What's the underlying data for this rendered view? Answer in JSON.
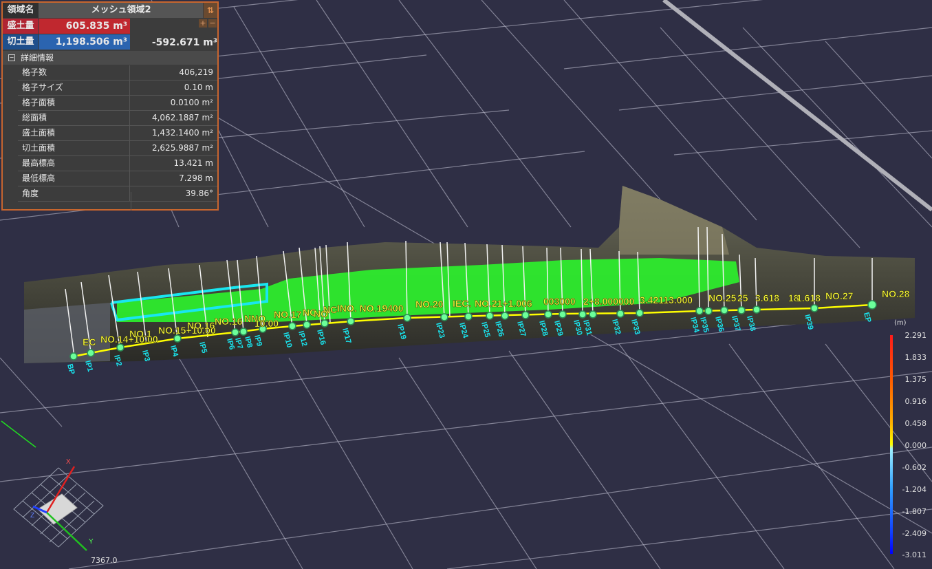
{
  "panel": {
    "name_label": "領域名",
    "name_value": "メッシュ領域2",
    "fill_label": "盛土量",
    "fill_value": "605.835 m³",
    "cut_label": "切土量",
    "cut_value": "1,198.506 m³",
    "net_value": "-592.671 m³",
    "sort_icon": "sort-arrows-icon",
    "plus": "+",
    "minus": "−",
    "detail_title": "詳細情報",
    "details": [
      {
        "key": "格子数",
        "value": "406,219"
      },
      {
        "key": "格子サイズ",
        "value": "0.10 m"
      },
      {
        "key": "格子面積",
        "value": "0.0100 m²"
      },
      {
        "key": "総面積",
        "value": "4,062.1887 m²"
      },
      {
        "key": "盛土面積",
        "value": "1,432.1400 m²"
      },
      {
        "key": "切土面積",
        "value": "2,625.9887 m²"
      },
      {
        "key": "最高標高",
        "value": "13.421 m"
      },
      {
        "key": "最低標高",
        "value": "7.298 m"
      },
      {
        "key": "角度",
        "value": "39.86°"
      }
    ]
  },
  "legend": {
    "unit": "(m)",
    "ticks": [
      "2.291",
      "1.833",
      "1.375",
      "0.916",
      "0.458",
      "0.000",
      "-0.602",
      "-1.204",
      "-1.807",
      "-2.409",
      "-3.011"
    ],
    "colors": {
      "max": "#ff1a1a",
      "zero": "#ffff00",
      "min": "#0000ff"
    }
  },
  "alignment": {
    "ip_labels": [
      "BP",
      "IP1",
      "IP2",
      "IP3",
      "IP4",
      "IP5",
      "IP6",
      "IP7",
      "IP8",
      "IP9",
      "IP10",
      "IP12",
      "IP16",
      "IP17",
      "IP19",
      "IP23",
      "IP24",
      "IP25",
      "IP26",
      "IP27",
      "IP28",
      "IP29",
      "IP30",
      "IP31",
      "IP32",
      "IP33",
      "IP34",
      "IP35",
      "IP36",
      "IP37",
      "IP38",
      "IP39",
      "EP"
    ],
    "station_labels": [
      "EC",
      "NO.14+10.00",
      "NO.1",
      "NO.15+10.00",
      "NO.16",
      "NO.16",
      "NNO.",
      "10.00",
      "NO.17",
      "NC",
      "NO",
      "NC",
      "INO. NO.19400",
      "NO.20",
      "IEC.",
      "NO.21+1.006",
      "003000",
      "2+8.000000",
      "3.42113.000",
      "NO.25",
      "25",
      "3.618",
      "18",
      "1.618",
      "NO.27",
      "NO.28"
    ],
    "line_color": "#ffff00",
    "marker_color": "#6cff9a"
  },
  "axes": {
    "x_label": "X",
    "y_label": "Y",
    "z_label": "Z",
    "coord_value": "7367.0"
  }
}
